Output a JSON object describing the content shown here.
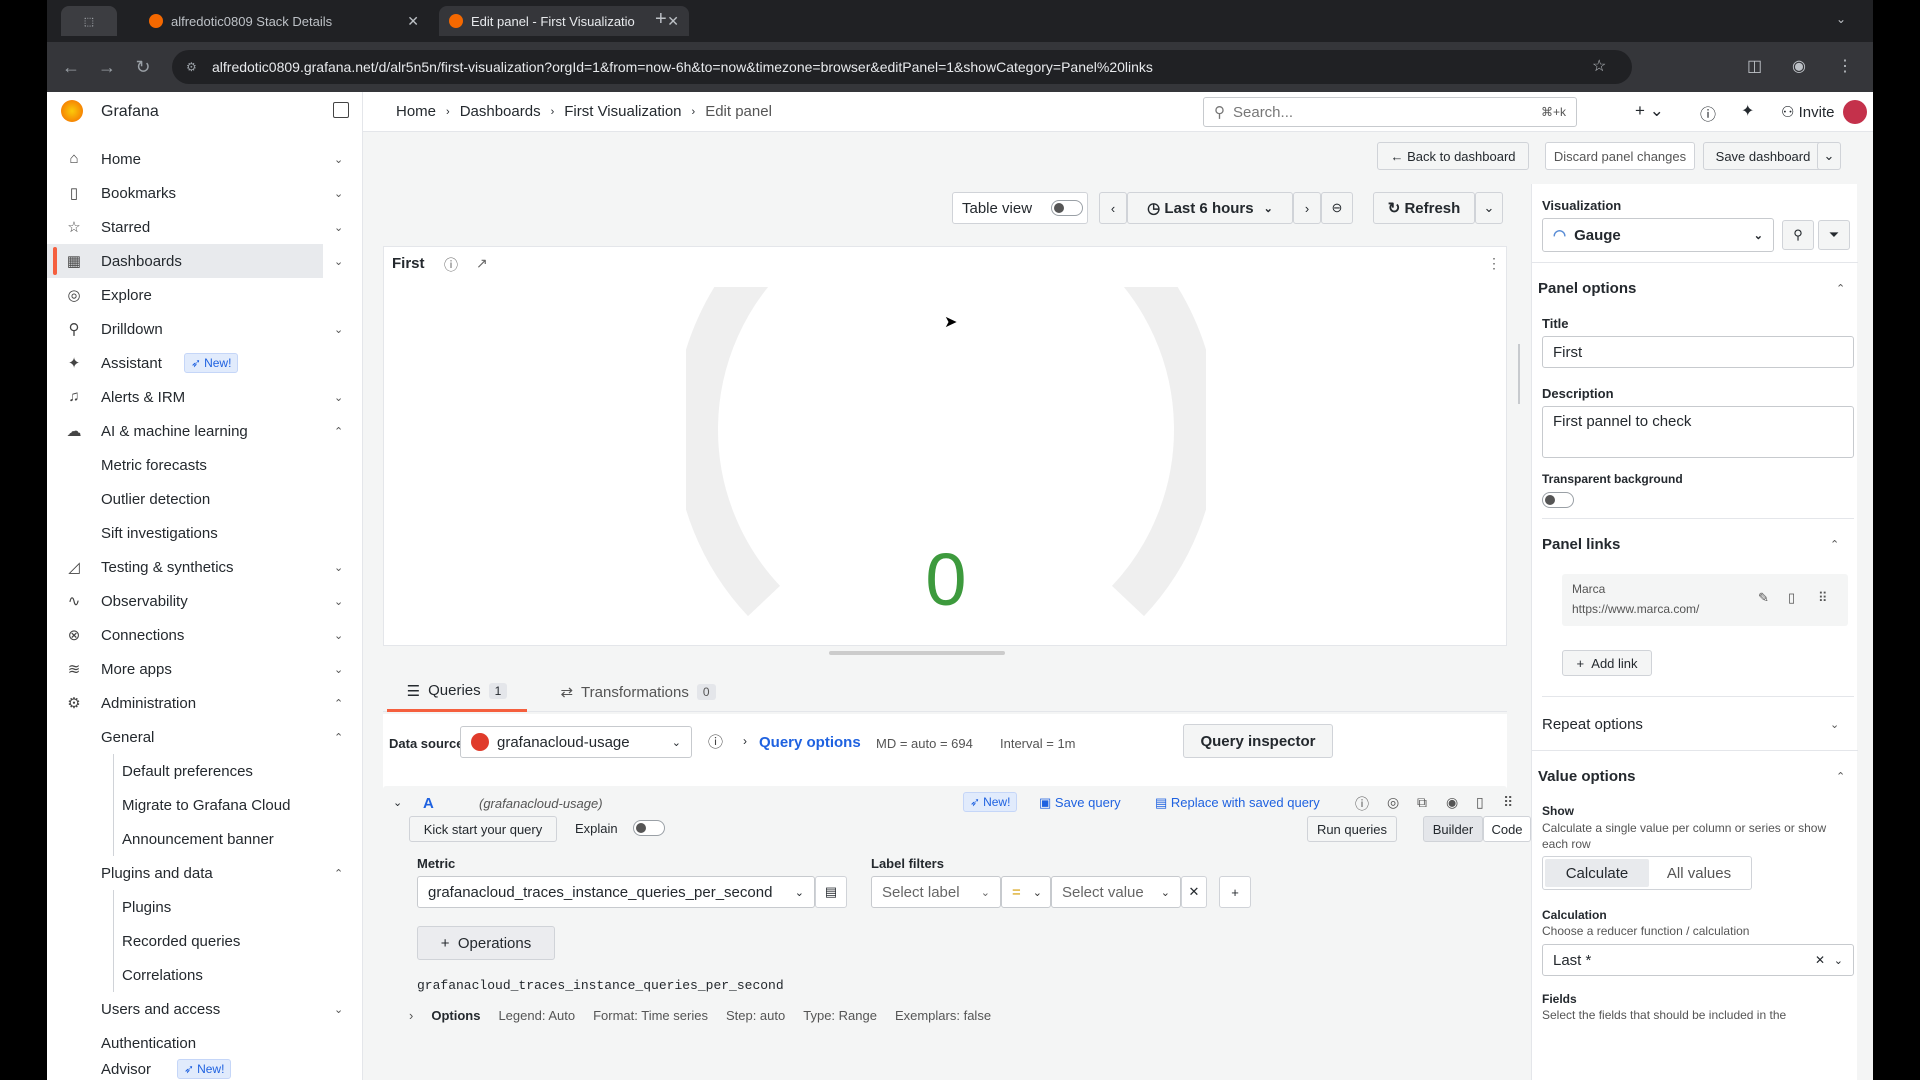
{
  "browser": {
    "tabs": [
      {
        "title": "alfredotic0809 Stack Details",
        "active": false
      },
      {
        "title": "Edit panel - First Visualizatio",
        "active": true
      }
    ],
    "url": "alfredotic0809.grafana.net/d/alr5n5n/first-visualization?orgId=1&from=now-6h&to=now&timezone=browser&editPanel=1&showCategory=Panel%20links"
  },
  "brand": "Grafana",
  "breadcrumb": [
    "Home",
    "Dashboards",
    "First Visualization",
    "Edit panel"
  ],
  "search": {
    "placeholder": "Search...",
    "shortcut": "⌘+k"
  },
  "topbar": {
    "invite": "Invite"
  },
  "actions": {
    "back": "Back to dashboard",
    "discard": "Discard panel changes",
    "save": "Save dashboard"
  },
  "nav": {
    "home": "Home",
    "bookmarks": "Bookmarks",
    "starred": "Starred",
    "dashboards": "Dashboards",
    "explore": "Explore",
    "drilldown": "Drilldown",
    "assistant": "Assistant",
    "new": "New!",
    "alerts": "Alerts & IRM",
    "ai": "AI & machine learning",
    "metric_forecasts": "Metric forecasts",
    "outlier": "Outlier detection",
    "sift": "Sift investigations",
    "testing": "Testing & synthetics",
    "observability": "Observability",
    "connections": "Connections",
    "more_apps": "More apps",
    "administration": "Administration",
    "general": "General",
    "default_prefs": "Default preferences",
    "migrate": "Migrate to Grafana Cloud",
    "announcement": "Announcement banner",
    "plugins_data": "Plugins and data",
    "plugins": "Plugins",
    "recorded": "Recorded queries",
    "correlations": "Correlations",
    "users_access": "Users and access",
    "authentication": "Authentication",
    "advisor": "Advisor"
  },
  "toolbar": {
    "table_view": "Table view",
    "time_range": "Last 6 hours",
    "refresh": "Refresh"
  },
  "panel": {
    "title": "First",
    "value": "0"
  },
  "tabs": {
    "queries": "Queries",
    "queries_count": "1",
    "transformations": "Transformations",
    "transformations_count": "0"
  },
  "query_bar": {
    "data_source_label": "Data source",
    "data_source": "grafanacloud-usage",
    "query_options": "Query options",
    "md": "MD = auto = 694",
    "interval": "Interval = 1m",
    "inspector": "Query inspector"
  },
  "query": {
    "ref": "A",
    "ds": "(grafanacloud-usage)",
    "new": "New!",
    "save_query": "Save query",
    "replace": "Replace with saved query",
    "kick_start": "Kick start your query",
    "explain": "Explain",
    "run": "Run queries",
    "builder": "Builder",
    "code": "Code",
    "metric_label": "Metric",
    "metric": "grafanacloud_traces_instance_queries_per_second",
    "label_filters": "Label filters",
    "select_label": "Select label",
    "op": "=",
    "select_value": "Select value",
    "operations": "Operations",
    "expr": "grafanacloud_traces_instance_queries_per_second",
    "options": "Options",
    "legend": "Legend: Auto",
    "format": "Format: Time series",
    "step": "Step: auto",
    "type": "Type: Range",
    "exemplars": "Exemplars: false"
  },
  "options_pane": {
    "viz_label": "Visualization",
    "viz": "Gauge",
    "panel_options": "Panel options",
    "title_label": "Title",
    "title": "First",
    "desc_label": "Description",
    "desc": "First pannel to check",
    "transparent": "Transparent background",
    "panel_links": "Panel links",
    "link_name": "Marca",
    "link_url": "https://www.marca.com/",
    "add_link": "Add link",
    "repeat": "Repeat options",
    "value_options": "Value options",
    "show_label": "Show",
    "show_desc": "Calculate a single value per column or series or show each row",
    "calculate": "Calculate",
    "all_values": "All values",
    "calc_label": "Calculation",
    "calc_desc": "Choose a reducer function / calculation",
    "calc_value": "Last *",
    "fields_label": "Fields",
    "fields_desc": "Select the fields that should be included in the"
  },
  "colors": {
    "accent": "#f55f3e",
    "link": "#1f62e0",
    "gauge_value": "#3d9a3d"
  }
}
